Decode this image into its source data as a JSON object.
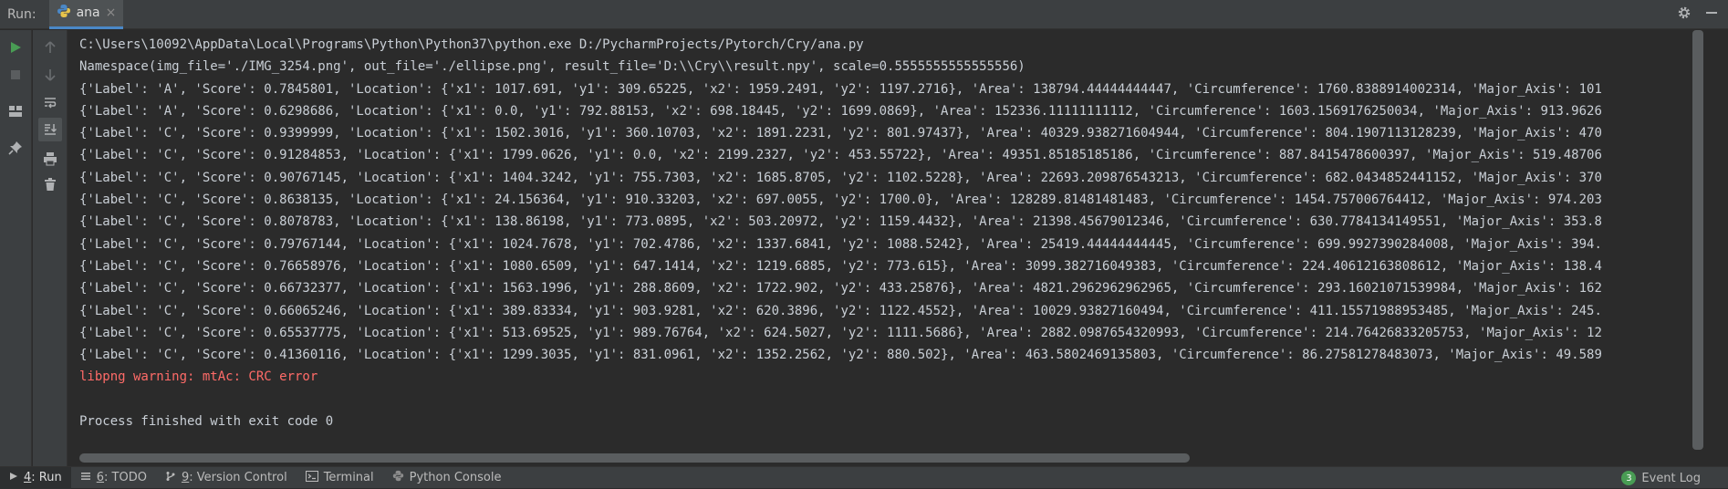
{
  "run_panel": {
    "label": "Run:",
    "tab_name": "ana",
    "tab_close": "×"
  },
  "console": {
    "lines": [
      {
        "text": "C:\\Users\\10092\\AppData\\Local\\Programs\\Python\\Python37\\python.exe D:/PycharmProjects/Pytorch/Cry/ana.py",
        "kind": "normal"
      },
      {
        "text": "Namespace(img_file='./IMG_3254.png', out_file='./ellipse.png', result_file='D:\\\\Cry\\\\result.npy', scale=0.5555555555555556)",
        "kind": "normal"
      },
      {
        "text": "{'Label': 'A', 'Score': 0.7845801, 'Location': {'x1': 1017.691, 'y1': 309.65225, 'x2': 1959.2491, 'y2': 1197.2716}, 'Area': 138794.44444444447, 'Circumference': 1760.8388914002314, 'Major_Axis': 101",
        "kind": "normal"
      },
      {
        "text": "{'Label': 'A', 'Score': 0.6298686, 'Location': {'x1': 0.0, 'y1': 792.88153, 'x2': 698.18445, 'y2': 1699.0869}, 'Area': 152336.11111111112, 'Circumference': 1603.1569176250034, 'Major_Axis': 913.9626",
        "kind": "normal"
      },
      {
        "text": "{'Label': 'C', 'Score': 0.9399999, 'Location': {'x1': 1502.3016, 'y1': 360.10703, 'x2': 1891.2231, 'y2': 801.97437}, 'Area': 40329.938271604944, 'Circumference': 804.1907113128239, 'Major_Axis': 470",
        "kind": "normal"
      },
      {
        "text": "{'Label': 'C', 'Score': 0.91284853, 'Location': {'x1': 1799.0626, 'y1': 0.0, 'x2': 2199.2327, 'y2': 453.55722}, 'Area': 49351.85185185186, 'Circumference': 887.8415478600397, 'Major_Axis': 519.48706",
        "kind": "normal"
      },
      {
        "text": "{'Label': 'C', 'Score': 0.90767145, 'Location': {'x1': 1404.3242, 'y1': 755.7303, 'x2': 1685.8705, 'y2': 1102.5228}, 'Area': 22693.209876543213, 'Circumference': 682.0434852441152, 'Major_Axis': 370",
        "kind": "normal"
      },
      {
        "text": "{'Label': 'C', 'Score': 0.8638135, 'Location': {'x1': 24.156364, 'y1': 910.33203, 'x2': 697.0055, 'y2': 1700.0}, 'Area': 128289.81481481483, 'Circumference': 1454.757006764412, 'Major_Axis': 974.203",
        "kind": "normal"
      },
      {
        "text": "{'Label': 'C', 'Score': 0.8078783, 'Location': {'x1': 138.86198, 'y1': 773.0895, 'x2': 503.20972, 'y2': 1159.4432}, 'Area': 21398.45679012346, 'Circumference': 630.7784134149551, 'Major_Axis': 353.8",
        "kind": "normal"
      },
      {
        "text": "{'Label': 'C', 'Score': 0.79767144, 'Location': {'x1': 1024.7678, 'y1': 702.4786, 'x2': 1337.6841, 'y2': 1088.5242}, 'Area': 25419.44444444445, 'Circumference': 699.9927390284008, 'Major_Axis': 394.",
        "kind": "normal"
      },
      {
        "text": "{'Label': 'C', 'Score': 0.76658976, 'Location': {'x1': 1080.6509, 'y1': 647.1414, 'x2': 1219.6885, 'y2': 773.615}, 'Area': 3099.382716049383, 'Circumference': 224.40612163808612, 'Major_Axis': 138.4",
        "kind": "normal"
      },
      {
        "text": "{'Label': 'C', 'Score': 0.66732377, 'Location': {'x1': 1563.1996, 'y1': 288.8609, 'x2': 1722.902, 'y2': 433.25876}, 'Area': 4821.2962962962965, 'Circumference': 293.16021071539984, 'Major_Axis': 162",
        "kind": "normal"
      },
      {
        "text": "{'Label': 'C', 'Score': 0.66065246, 'Location': {'x1': 389.83334, 'y1': 903.9281, 'x2': 620.3896, 'y2': 1122.4552}, 'Area': 10029.93827160494, 'Circumference': 411.15571988953485, 'Major_Axis': 245.",
        "kind": "normal"
      },
      {
        "text": "{'Label': 'C', 'Score': 0.65537775, 'Location': {'x1': 513.69525, 'y1': 989.76764, 'x2': 624.5027, 'y2': 1111.5686}, 'Area': 2882.0987654320993, 'Circumference': 214.76426833205753, 'Major_Axis': 12",
        "kind": "normal"
      },
      {
        "text": "{'Label': 'C', 'Score': 0.41360116, 'Location': {'x1': 1299.3035, 'y1': 831.0961, 'x2': 1352.2562, 'y2': 880.502}, 'Area': 463.5802469135803, 'Circumference': 86.27581278483073, 'Major_Axis': 49.589",
        "kind": "normal"
      },
      {
        "text": "libpng warning: mtAc: CRC error",
        "kind": "err"
      },
      {
        "text": "",
        "kind": "blank"
      },
      {
        "text": "Process finished with exit code 0",
        "kind": "normal"
      }
    ]
  },
  "statusbar": {
    "run": {
      "num": "4",
      "label": ": Run"
    },
    "todo": {
      "num": "6",
      "label": ": TODO"
    },
    "vcs": {
      "num": "9",
      "label": ": Version Control"
    },
    "terminal": {
      "label": "Terminal"
    },
    "python_console": {
      "label": "Python Console"
    },
    "event_log": {
      "count": "3",
      "label": "Event Log"
    }
  },
  "icons": {
    "python": "python-icon",
    "settings": "gear-icon",
    "minimize": "minimize-icon",
    "run": "play-icon",
    "stop": "stop-icon",
    "up": "arrow-up-icon",
    "down": "arrow-down-icon",
    "wrap": "soft-wrap-icon",
    "scroll_end": "scroll-to-end-icon",
    "print": "print-icon",
    "trash": "trash-icon",
    "layout": "layout-icon",
    "pin": "pin-icon"
  },
  "colors": {
    "accent": "#4a88c7",
    "run_green": "#499c54",
    "error_red": "#ff6b68"
  }
}
